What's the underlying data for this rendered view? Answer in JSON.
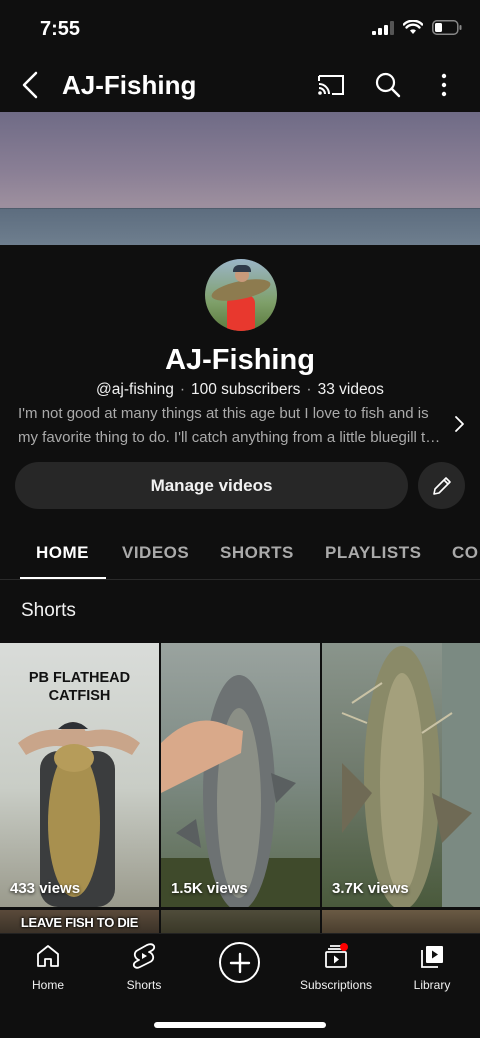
{
  "status_bar": {
    "time": "7:55"
  },
  "app_bar": {
    "title": "AJ-Fishing"
  },
  "channel": {
    "name": "AJ-Fishing",
    "handle": "@aj-fishing",
    "subscribers": "100 subscribers",
    "videos": "33 videos",
    "description": "I'm not good at many things at this age but I love to fish and is my favorite thing to do. I'll catch anything from a little bluegill to a big catfish."
  },
  "actions": {
    "manage_videos_label": "Manage videos"
  },
  "tabs": [
    {
      "label": "HOME",
      "active": true
    },
    {
      "label": "VIDEOS",
      "active": false
    },
    {
      "label": "SHORTS",
      "active": false
    },
    {
      "label": "PLAYLISTS",
      "active": false
    },
    {
      "label": "CO",
      "active": false
    }
  ],
  "shorts_section": {
    "title": "Shorts",
    "items": [
      {
        "views": "433 views",
        "caption": "PB FLATHEAD\nCATFISH"
      },
      {
        "views": "1.5K views",
        "caption": ""
      },
      {
        "views": "3.7K views",
        "caption": ""
      }
    ],
    "row2_caption": "LEAVE FISH TO DIE"
  },
  "bottom_nav": [
    {
      "label": "Home",
      "icon": "home-icon"
    },
    {
      "label": "Shorts",
      "icon": "shorts-icon"
    },
    {
      "label": "",
      "icon": "create-icon"
    },
    {
      "label": "Subscriptions",
      "icon": "subscriptions-icon"
    },
    {
      "label": "Library",
      "icon": "library-icon"
    }
  ],
  "colors": {
    "background": "#0f0f0f",
    "surface": "#272727",
    "secondary_text": "#aaaaaa",
    "notification_dot": "#ff0000"
  }
}
